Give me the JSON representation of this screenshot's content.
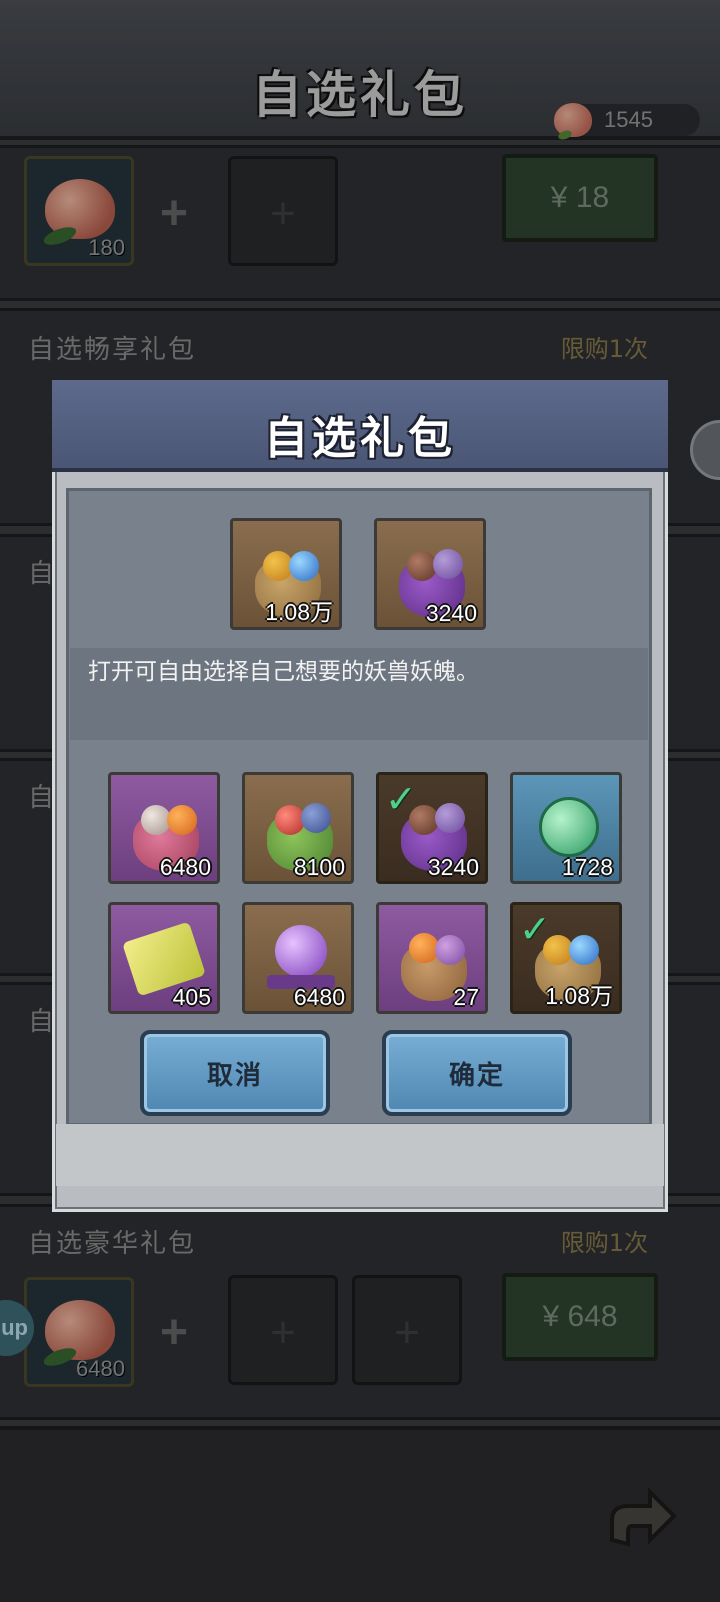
{
  "page": {
    "title": "自选礼包",
    "currency_amount": "1545"
  },
  "rows": [
    {
      "label": "",
      "limit": "",
      "slot_count": "180",
      "price": "¥ 18"
    },
    {
      "label": "自选畅享礼包",
      "limit": "限购1次"
    },
    {
      "label": "自"
    },
    {
      "label": "自"
    },
    {
      "label": "自"
    },
    {
      "label": "自选豪华礼包",
      "limit": "限购1次",
      "slot_count": "6480",
      "price": "¥ 648"
    }
  ],
  "side_bubble_left": "up",
  "modal": {
    "title": "自选礼包",
    "preview": [
      {
        "count": "1.08万",
        "icon": "bag-gold-blue-icon"
      },
      {
        "count": "3240",
        "icon": "bag-purple-brown-icon"
      }
    ],
    "description": "打开可自由选择自己想要的妖兽妖魄。",
    "options": [
      {
        "count": "6480",
        "icon": "bag-pink-skull-icon",
        "selected": false
      },
      {
        "count": "8100",
        "icon": "bag-green-red-icon",
        "selected": false
      },
      {
        "count": "3240",
        "icon": "bag-purple-brown-icon",
        "selected": true
      },
      {
        "count": "1728",
        "icon": "green-jade-orb-icon",
        "selected": false
      },
      {
        "count": "405",
        "icon": "yellow-scroll-icon",
        "selected": false
      },
      {
        "count": "6480",
        "icon": "purple-orb-icon",
        "selected": false
      },
      {
        "count": "27",
        "icon": "bag-orange-purple-icon",
        "selected": false
      },
      {
        "count": "1.08万",
        "icon": "bag-gold-blue-icon",
        "selected": true
      }
    ],
    "cancel_label": "取消",
    "confirm_label": "确定"
  },
  "colors": {
    "accent_blue": "#5c8fb8",
    "check_green": "#4fd08a",
    "price_green": "#2f4530"
  }
}
